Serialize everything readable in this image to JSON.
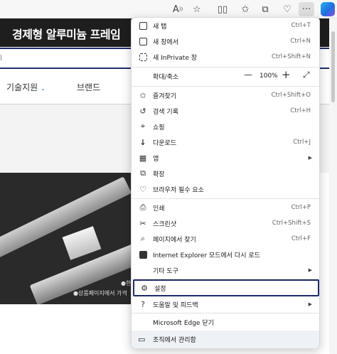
{
  "browser": {
    "toolbar_icons": [
      "read-aloud-icon",
      "favorite-star-icon",
      "split-screen-icon",
      "favorites-icon",
      "collections-icon",
      "browser-essentials-icon",
      "more-menu-icon",
      "copilot-icon"
    ],
    "read_aloud_glyph": "A",
    "more_glyph": "···"
  },
  "page": {
    "banner_title": "경제형 알루미늄 프레임",
    "search_fragment": "l",
    "nav": {
      "tech_support": "기술지원",
      "brand": "브랜드"
    },
    "product_text_1": "●한",
    "product_text_2": "●상품페이지에서 가격"
  },
  "menu": {
    "items": [
      {
        "label": "새 탭",
        "shortcut": "Ctrl+T",
        "icon": "new-tab-icon"
      },
      {
        "label": "새 창에서",
        "shortcut": "Ctrl+N",
        "icon": "new-window-icon"
      },
      {
        "label": "새 InPrivate 창",
        "shortcut": "Ctrl+Shift+N",
        "icon": "inprivate-icon"
      },
      {
        "label": "확대/축소",
        "zoom": "100%"
      },
      {
        "label": "즐겨찾기",
        "shortcut": "Ctrl+Shift+O",
        "icon": "favorites-icon"
      },
      {
        "label": "검색 기록",
        "shortcut": "Ctrl+H",
        "icon": "history-icon"
      },
      {
        "label": "쇼핑",
        "icon": "shopping-icon"
      },
      {
        "label": "다운로드",
        "shortcut": "Ctrl+J",
        "icon": "download-icon"
      },
      {
        "label": "앱",
        "icon": "apps-icon"
      },
      {
        "label": "확장",
        "icon": "extensions-icon"
      },
      {
        "label": "브라우저 필수 요소",
        "icon": "browser-essentials-icon"
      },
      {
        "label": "인쇄",
        "shortcut": "Ctrl+P",
        "icon": "print-icon"
      },
      {
        "label": "스크린샷",
        "shortcut": "Ctrl+Shift+S",
        "icon": "screenshot-icon"
      },
      {
        "label": "페이지에서 찾기",
        "shortcut": "Ctrl+F",
        "icon": "find-icon"
      },
      {
        "label": "Internet Explorer 모드에서 다시 로드",
        "icon": "ie-mode-icon"
      },
      {
        "label": "기타 도구"
      },
      {
        "label": "설정",
        "icon": "settings-icon"
      },
      {
        "label": "도움말 및 피드백",
        "icon": "help-icon"
      },
      {
        "label": "Microsoft Edge 닫기"
      },
      {
        "label": "조직에서 관리함",
        "icon": "managed-icon"
      }
    ],
    "zoom_minus": "—",
    "zoom_plus": "+"
  },
  "colors": {
    "highlight": "#1f2b6b",
    "banner": "#1e1e1e"
  }
}
